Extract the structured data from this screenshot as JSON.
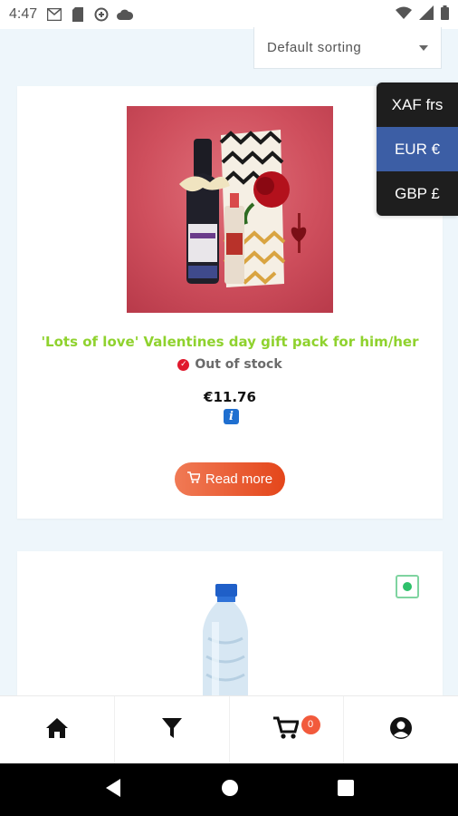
{
  "status_bar": {
    "time": "4:47",
    "left_icons": [
      "gmail-icon",
      "sim-card-icon",
      "data-saver-icon",
      "cloud-icon"
    ],
    "right_icons": [
      "wifi-icon",
      "signal-icon",
      "battery-icon"
    ]
  },
  "sort": {
    "selected": "Default sorting"
  },
  "currency": {
    "options": [
      "XAF frs",
      "EUR €",
      "GBP £"
    ],
    "active": "EUR €"
  },
  "products": [
    {
      "title": "'Lots of love' Valentines day gift pack for him/her",
      "stock_status": "Out of stock",
      "price": "€11.76",
      "button_label": "Read more"
    }
  ],
  "bottom_nav": {
    "items": [
      "home-icon",
      "filter-icon",
      "cart-icon",
      "account-icon"
    ],
    "cart_count": "0"
  },
  "colors": {
    "title_green": "#8fd22e",
    "accent_orange": "#e4461b",
    "currency_active": "#3c5ea5",
    "currency_bg": "#1e1e1e"
  }
}
